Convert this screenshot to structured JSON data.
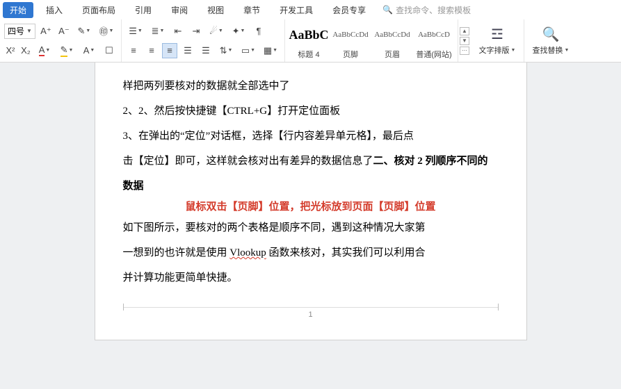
{
  "menu": {
    "tabs": [
      "开始",
      "插入",
      "页面布局",
      "引用",
      "审阅",
      "视图",
      "章节",
      "开发工具",
      "会员专享"
    ],
    "active_index": 0,
    "search_placeholder": "查找命令、搜索模板"
  },
  "ribbon": {
    "font_size": "四号",
    "styles": {
      "cells": [
        "AaBbC",
        "AaBbCcDd",
        "AaBbCcDd",
        "AaBbCcD"
      ],
      "labels": [
        "标题 4",
        "页脚",
        "页眉",
        "普通(网站)"
      ]
    },
    "text_layout": "文字排版",
    "find_replace": "查找替换"
  },
  "doc": {
    "lines": [
      "样把两列要核对的数据就全部选中了",
      "2、2、然后按快捷键【CTRL+G】打开定位面板",
      "3、在弹出的“定位”对话框，选择【行内容差异单元格】，最后点",
      "击【定位】即可，这样就会核对出有差异的数据信息了",
      "二、核对 2 列顺序不同的数据",
      "鼠标双击【页脚】位置，把光标放到页面【页脚】位置",
      "如下图所示，要核对的两个表格是顺序不同，遇到这种情况大家第",
      "一想到的也许就是使用 ",
      "Vlookup",
      " 函数来核对，其实我们可以利用合",
      "并计算功能更简单快捷。"
    ],
    "page_number": "1"
  }
}
